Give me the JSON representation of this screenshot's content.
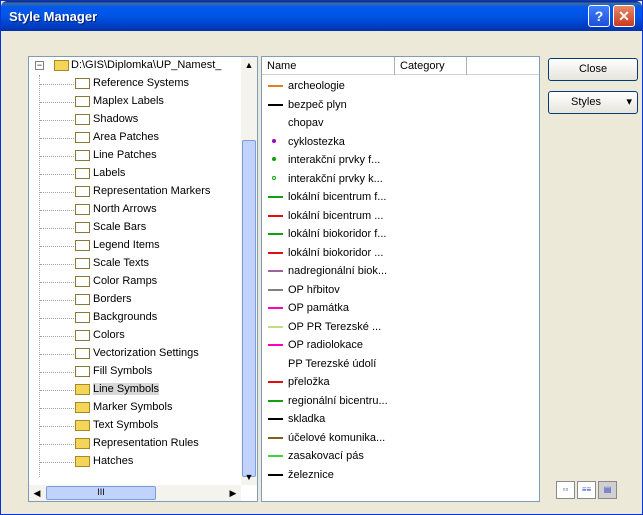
{
  "window": {
    "title": "Style Manager"
  },
  "tree": {
    "root": "D:\\GIS\\Diplomka\\UP_Namest_",
    "items": [
      "Reference Systems",
      "Maplex Labels",
      "Shadows",
      "Area Patches",
      "Line Patches",
      "Labels",
      "Representation Markers",
      "North Arrows",
      "Scale Bars",
      "Legend Items",
      "Scale Texts",
      "Color Ramps",
      "Borders",
      "Backgrounds",
      "Colors",
      "Vectorization Settings",
      "Fill Symbols",
      "Line Symbols",
      "Marker Symbols",
      "Text Symbols",
      "Representation Rules",
      "Hatches"
    ],
    "hscroll_grip": "III"
  },
  "list": {
    "col_name": "Name",
    "col_category": "Category",
    "rows": [
      {
        "name": "archeologie",
        "color": "#e08020"
      },
      {
        "name": "bezpeč plyn",
        "color": "#000000"
      },
      {
        "name": "chopav",
        "color": ""
      },
      {
        "name": "cyklostezka",
        "color": "#a000c0"
      },
      {
        "name": "interakční prvky f...",
        "color": "#10a010"
      },
      {
        "name": "interakční prvky k...",
        "color": "#10a010"
      },
      {
        "name": "lokální bicentrum f...",
        "color": "#10a010"
      },
      {
        "name": "lokální bicentrum ...",
        "color": "#e01010"
      },
      {
        "name": "lokální biokoridor f...",
        "color": "#10a010"
      },
      {
        "name": "lokální biokoridor ...",
        "color": "#e01010"
      },
      {
        "name": "nadregionální biok...",
        "color": "#a060a0"
      },
      {
        "name": "OP hřbitov",
        "color": "#808080"
      },
      {
        "name": "OP památka",
        "color": "#ff00c0"
      },
      {
        "name": "OP PR Terezské ...",
        "color": "#c0e080"
      },
      {
        "name": "OP radiolokace",
        "color": "#ff00c0"
      },
      {
        "name": "PP Terezské údolí",
        "color": ""
      },
      {
        "name": "přeložka",
        "color": "#e01010"
      },
      {
        "name": "regionální bicentru...",
        "color": "#10a010"
      },
      {
        "name": "skladka",
        "color": "#000000"
      },
      {
        "name": "účelové komunika...",
        "color": "#806020"
      },
      {
        "name": "zasakovací pás",
        "color": "#40d040"
      },
      {
        "name": "železnice",
        "color": "#000000"
      }
    ]
  },
  "buttons": {
    "close": "Close",
    "styles": "Styles",
    "styles_arrow": "▾"
  },
  "view_icons": [
    "large-icons",
    "list",
    "details"
  ]
}
